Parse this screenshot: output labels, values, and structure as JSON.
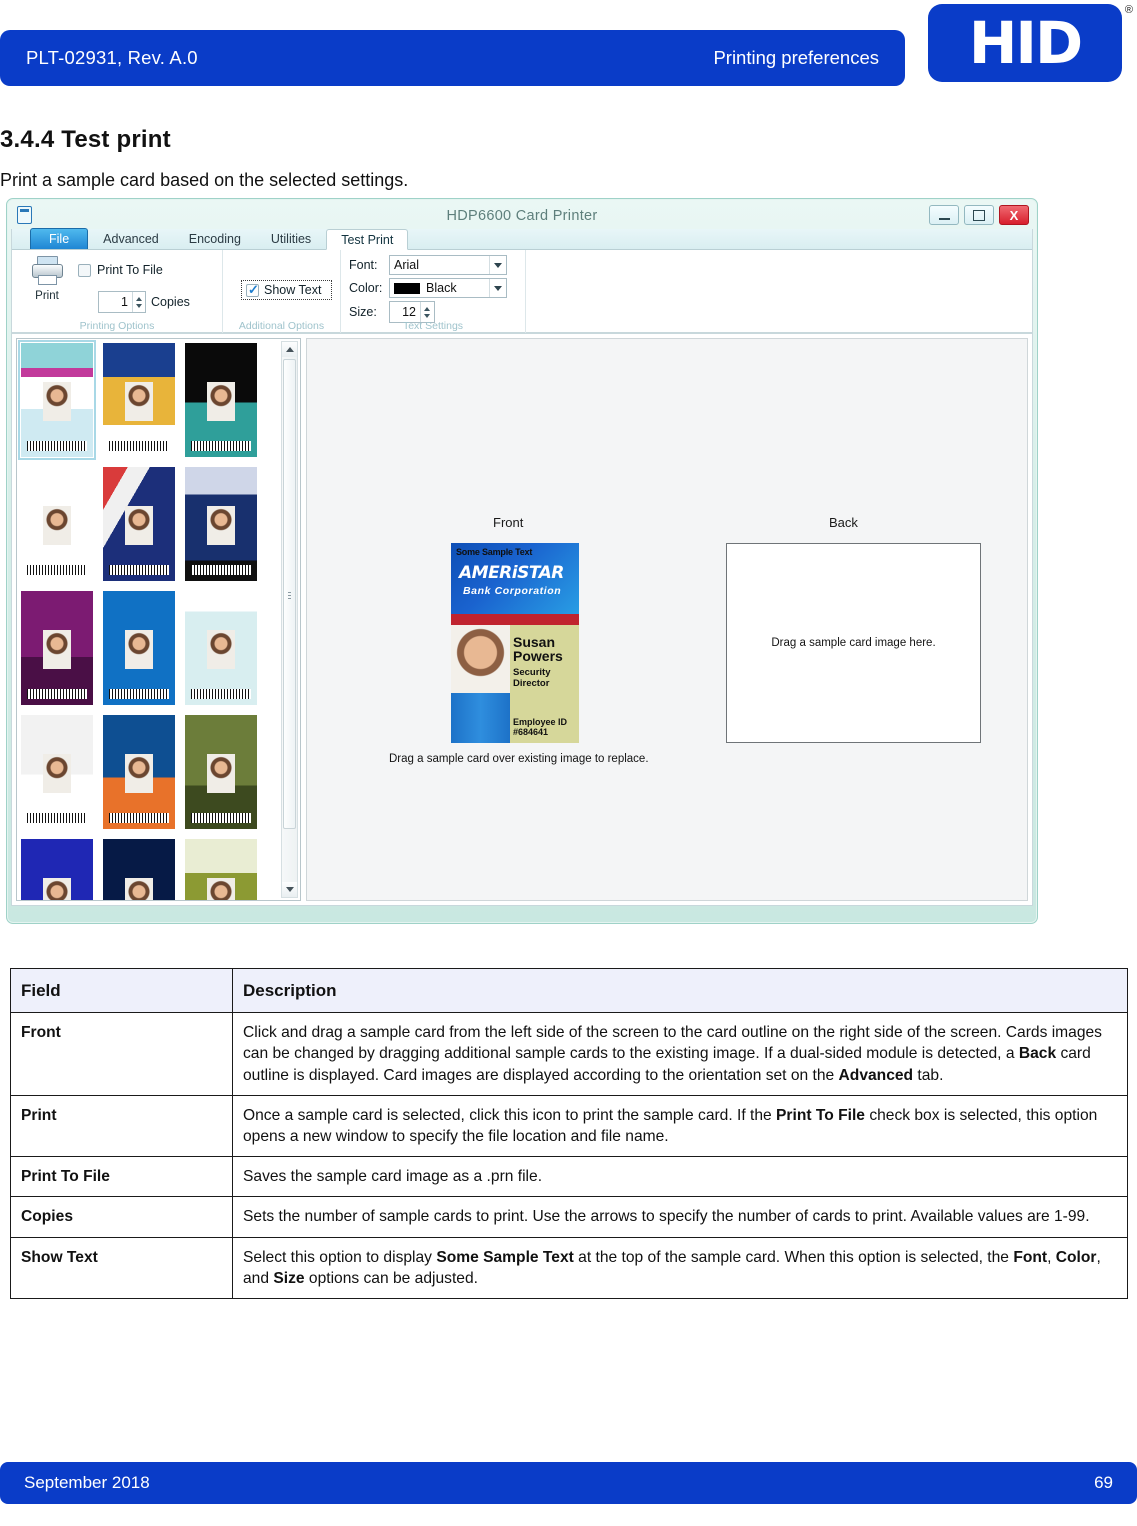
{
  "header": {
    "doc_id": "PLT-02931, Rev. A.0",
    "title": "Printing preferences",
    "logo_text": "HID",
    "logo_registered": "®"
  },
  "section": {
    "heading": "3.4.4 Test print",
    "intro": "Print a sample card based on the selected settings."
  },
  "dialog": {
    "title": "HDP6600 Card Printer",
    "window_buttons": {
      "minimize": "–",
      "maximize": "□",
      "close": "X"
    },
    "tabs": [
      {
        "label": "File",
        "state": "file"
      },
      {
        "label": "Advanced",
        "state": "normal"
      },
      {
        "label": "Encoding",
        "state": "normal"
      },
      {
        "label": "Utilities",
        "state": "normal"
      },
      {
        "label": "Test Print",
        "state": "active"
      }
    ],
    "ribbon": {
      "printing_options": {
        "group_label": "Printing Options",
        "print_label": "Print",
        "print_to_file_label": "Print To File",
        "print_to_file_checked": false,
        "copies_value": "1",
        "copies_label": "Copies"
      },
      "additional_options": {
        "group_label": "Additional Options",
        "show_text_label": "Show Text",
        "show_text_checked": true
      },
      "text_settings": {
        "group_label": "Text Settings",
        "font_label": "Font:",
        "font_value": "Arial",
        "color_label": "Color:",
        "color_value": "Black",
        "color_hex": "#000000",
        "size_label": "Size:",
        "size_value": "12"
      }
    },
    "preview": {
      "front_label": "Front",
      "back_label": "Back",
      "back_placeholder": "Drag a sample card image here.",
      "hint": "Drag a sample card over existing image to replace.",
      "front_card": {
        "sample_text": "Some Sample Text",
        "brand": "AMERiSTAR",
        "brand_sub": "Bank Corporation",
        "name_line1": "Susan",
        "name_line2": "Powers",
        "title_line1": "Security",
        "title_line2": "Director",
        "employee_id_line1": "Employee ID",
        "employee_id_line2": "#684641"
      }
    },
    "gallery": {
      "selected_index": 0,
      "cards": [
        {
          "name": "ameristar-susan-powers",
          "accent": "#1b63cf"
        },
        {
          "name": "atlantic-hotel-shandra-kabir",
          "accent": "#1a3f8f"
        },
        {
          "name": "axess-internet-richard-mccain",
          "accent": "#0a0a0a"
        },
        {
          "name": "axess-internet-visitor",
          "accent": "#ffffff"
        },
        {
          "name": "us-flag-hall-lawrence",
          "accent": "#1c2f7a"
        },
        {
          "name": "east-high-saints-rachael-robinson",
          "accent": "#18306e"
        },
        {
          "name": "frankfurt-institute-michael-wilcox",
          "accent": "#7c1b72"
        },
        {
          "name": "garfield-grizzlies-steve-schmitt",
          "accent": "#1071c4"
        },
        {
          "name": "hayes-county-judge-thomas-moore",
          "accent": "#d8eef0"
        },
        {
          "name": "janet-chen-government-id",
          "accent": "#f2f2f2"
        },
        {
          "name": "metro-transit-james-wong",
          "accent": "#0e4f92"
        },
        {
          "name": "first-mortgage-lisa-yamata",
          "accent": "#6c7d3a"
        },
        {
          "name": "united-states-security-carol-phillips",
          "accent": "#1f27b4"
        },
        {
          "name": "intelligent-technology-inc",
          "accent": "#061a46"
        },
        {
          "name": "us-guard-spc-rebecca-montes",
          "accent": "#8c9a33"
        }
      ]
    }
  },
  "table": {
    "headers": [
      "Field",
      "Description"
    ],
    "rows": [
      {
        "field": "Front",
        "description_html": "Click and drag a sample card from the left side of the screen to the card outline on the right side of the screen. Cards images can be changed by dragging additional sample cards to the existing image. If a dual-sided module is detected, a <b>Back</b> card outline is displayed. Card images are displayed according to the orientation set on the <b>Advanced</b> tab."
      },
      {
        "field": "Print",
        "description_html": "Once a sample card is selected, click this icon to print the sample card. If the <b>Print To File</b> check box is selected, this option opens a new window to specify the file location and file name."
      },
      {
        "field": "Print To File",
        "description_html": "Saves the sample card image as a .prn file."
      },
      {
        "field": "Copies",
        "description_html": "Sets the number of sample cards to print. Use the arrows to specify the number of cards to print. Available values are 1-99."
      },
      {
        "field": "Show Text",
        "description_html": "Select this option to display <b>Some Sample Text</b> at the top of the sample card. When this option is selected, the <b>Font</b>, <b>Color</b>, and <b>Size</b> options can be adjusted."
      }
    ]
  },
  "footer": {
    "date": "September 2018",
    "page_number": "69"
  },
  "colors": {
    "brand_blue": "#0a3cc8",
    "table_header_bg": "#eef0fb",
    "dialog_titlebar": "#c9e8e1",
    "tab_file_blue": "#1f86d4"
  }
}
